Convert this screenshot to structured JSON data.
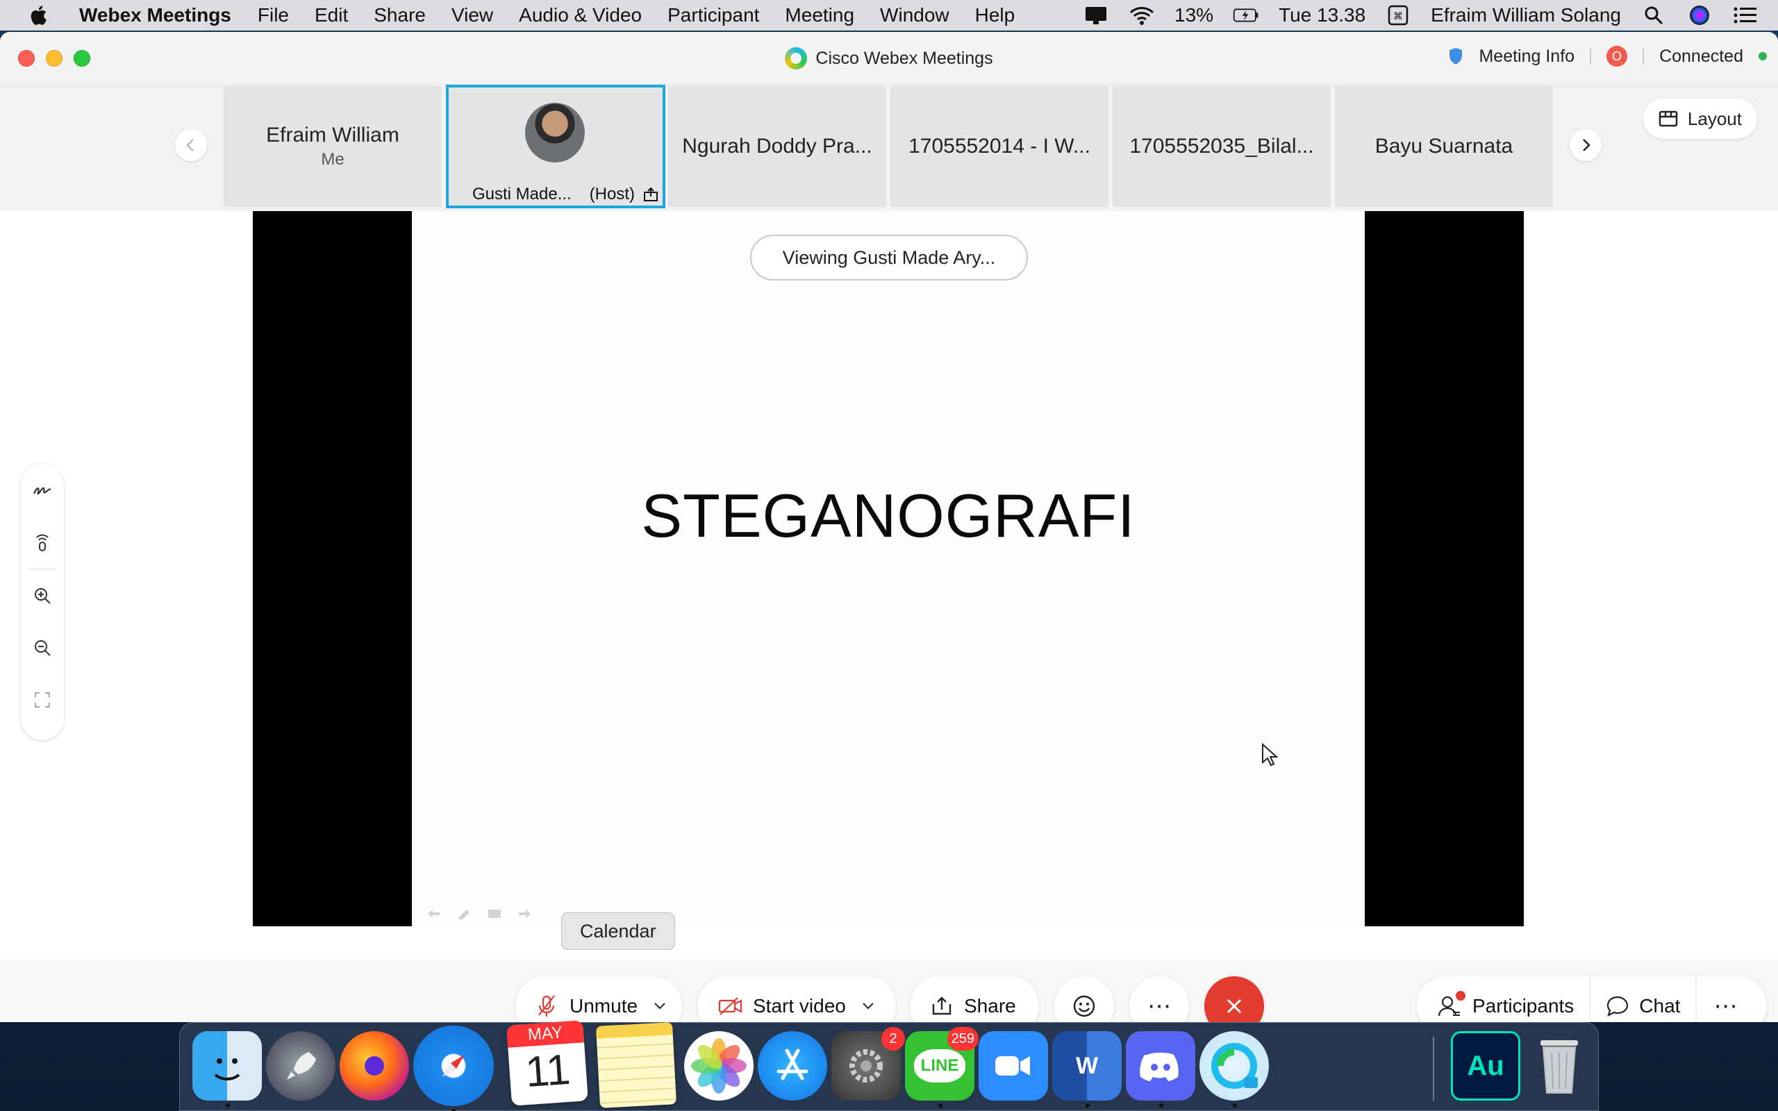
{
  "menubar": {
    "app_name": "Webex Meetings",
    "items": [
      "File",
      "Edit",
      "Share",
      "View",
      "Audio & Video",
      "Participant",
      "Meeting",
      "Window",
      "Help"
    ],
    "battery": "13%",
    "clock": "Tue 13.38",
    "user": "Efraim William Solang"
  },
  "window": {
    "title": "Cisco Webex Meetings",
    "meeting_info": "Meeting Info",
    "status": "Connected",
    "record_icon_text": "O"
  },
  "filmstrip": {
    "tiles": [
      {
        "name": "Efraim William",
        "sub": "Me"
      },
      {
        "name": "Gusti Made...",
        "sub": "(Host)"
      },
      {
        "name": "Ngurah Doddy Pra..."
      },
      {
        "name": "1705552014 - I W..."
      },
      {
        "name": "1705552035_Bilal..."
      },
      {
        "name": "Bayu Suarnata"
      }
    ],
    "layout_label": "Layout"
  },
  "share": {
    "viewing_label": "Viewing Gusti Made Ary...",
    "slide_title": "STEGANOGRAFI"
  },
  "controls": {
    "unmute": "Unmute",
    "start_video": "Start video",
    "share": "Share",
    "more": "⋯",
    "participants": "Participants",
    "chat": "Chat",
    "tooltip": "Calendar"
  },
  "dock": {
    "calendar_month": "MAY",
    "calendar_day": "11",
    "settings_badge": "2",
    "line_badge": "259",
    "line_label": "LINE",
    "word_label": "W",
    "audition_label": "Au"
  },
  "colors": {
    "accent": "#1ea6e0",
    "end_call": "#e33b2e",
    "connected": "#2ab456"
  }
}
